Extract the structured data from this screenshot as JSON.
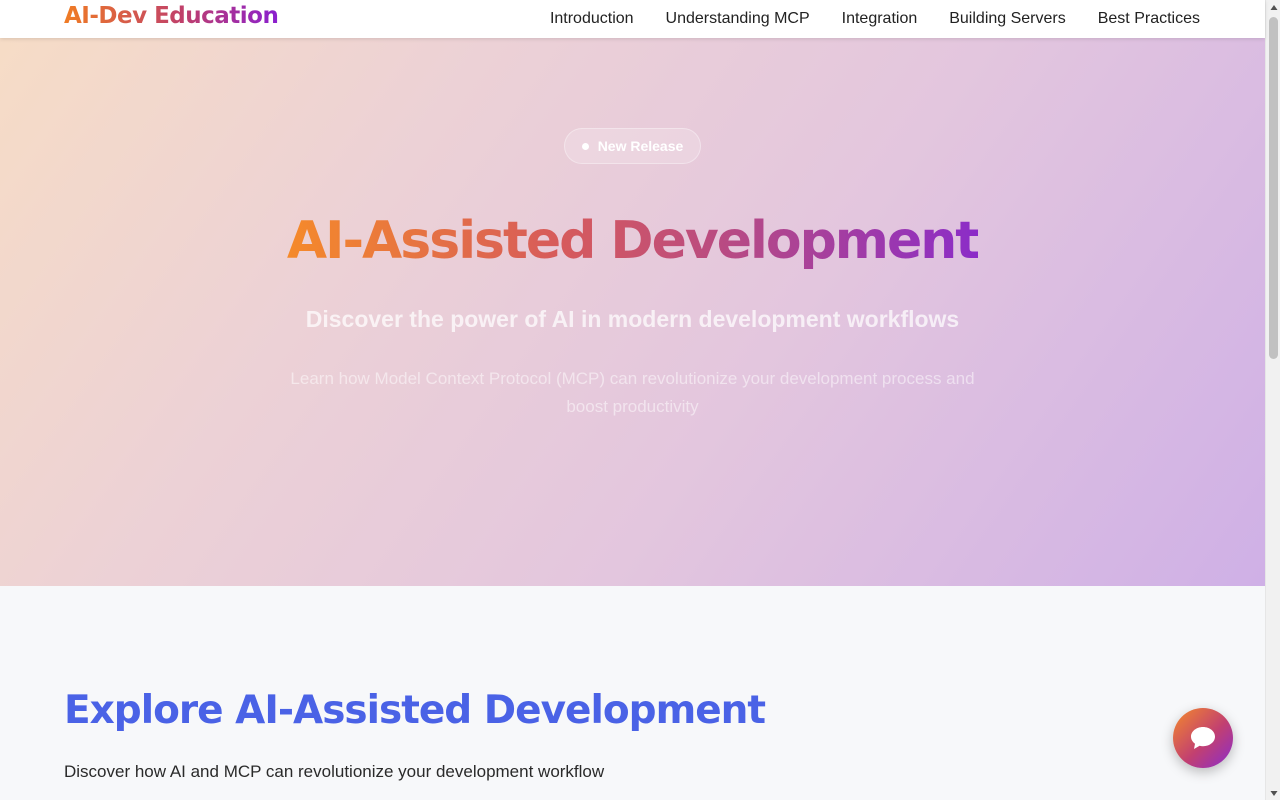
{
  "header": {
    "logo": "AI-Dev Education",
    "nav": [
      "Introduction",
      "Understanding MCP",
      "Integration",
      "Building Servers",
      "Best Practices"
    ]
  },
  "hero": {
    "badge": "New Release",
    "title": "AI-Assisted Development",
    "subtitle": "Discover the power of AI in modern development workflows",
    "description": "Learn how Model Context Protocol (MCP) can revolutionize your development process and boost productivity"
  },
  "explore": {
    "title": "Explore AI-Assisted Development",
    "description": "Discover how AI and MCP can revolutionize your development workflow"
  },
  "icons": {
    "chat": "chat-bubble-icon",
    "badge_dot": "dot-icon",
    "scroll_up": "arrow-up-icon",
    "scroll_down": "arrow-down-icon"
  },
  "colors": {
    "brand_orange": "#f07c24",
    "brand_purple": "#8a1fcf",
    "explore_title": "#4a62e6"
  }
}
